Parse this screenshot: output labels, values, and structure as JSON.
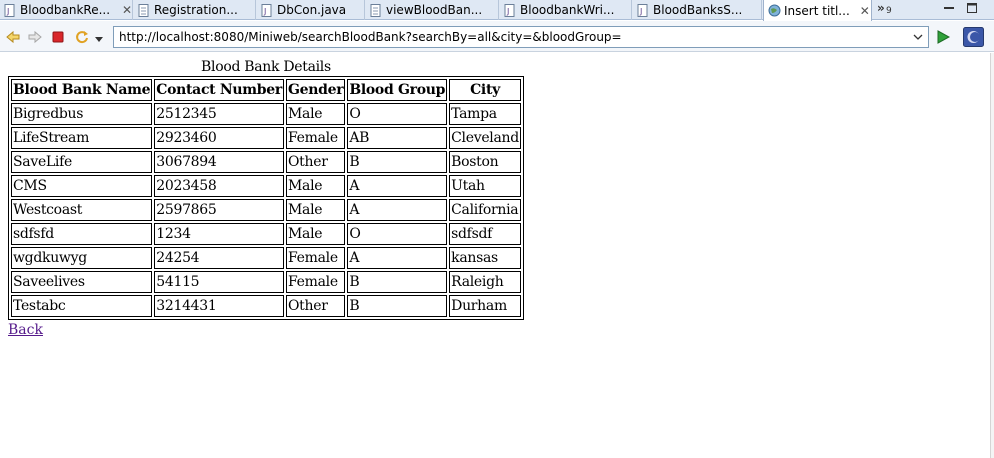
{
  "tabs": [
    {
      "label": "BloodbankRe...",
      "icon": "java-file-icon",
      "active": false,
      "close": "✕"
    },
    {
      "label": "Registration...",
      "icon": "document-icon",
      "active": false
    },
    {
      "label": "DbCon.java",
      "icon": "java-file-icon",
      "active": false
    },
    {
      "label": "viewBloodBan...",
      "icon": "document-icon",
      "active": false
    },
    {
      "label": "BloodbankWri...",
      "icon": "java-file-icon",
      "active": false
    },
    {
      "label": "BloodBanksS...",
      "icon": "java-file-icon",
      "active": false
    },
    {
      "label": "Insert titl...",
      "icon": "globe-icon",
      "active": true,
      "close": "✕"
    }
  ],
  "tab_overflow": {
    "chevron": "»",
    "count": "9"
  },
  "url": "http://localhost:8080/Miniweb/searchBloodBank?searchBy=all&city=&bloodGroup=",
  "table": {
    "caption": "Blood Bank Details",
    "headers": [
      "Blood Bank Name",
      "Contact Number",
      "Gender",
      "Blood Group",
      "City"
    ],
    "rows": [
      [
        "Bigredbus",
        "2512345",
        "Male",
        "O",
        "Tampa"
      ],
      [
        "LifeStream",
        "2923460",
        "Female",
        "AB",
        "Cleveland"
      ],
      [
        "SaveLife",
        "3067894",
        "Other",
        "B",
        "Boston"
      ],
      [
        "CMS",
        "2023458",
        "Male",
        "A",
        "Utah"
      ],
      [
        "Westcoast",
        "2597865",
        "Male",
        "A",
        "California"
      ],
      [
        "sdfsfd",
        "1234",
        "Male",
        "O",
        "sdfsdf"
      ],
      [
        "wgdkuwyg",
        "24254",
        "Female",
        "A",
        "kansas"
      ],
      [
        "Saveelives",
        "54115",
        "Female",
        "B",
        "Raleigh"
      ],
      [
        "Testabc",
        "3214431",
        "Other",
        "B",
        "Durham"
      ]
    ]
  },
  "back_link": "Back",
  "colors": {
    "link_visited": "#551a8b",
    "tab_bg": "#dfe8f4",
    "url_border": "#7f9db9"
  }
}
